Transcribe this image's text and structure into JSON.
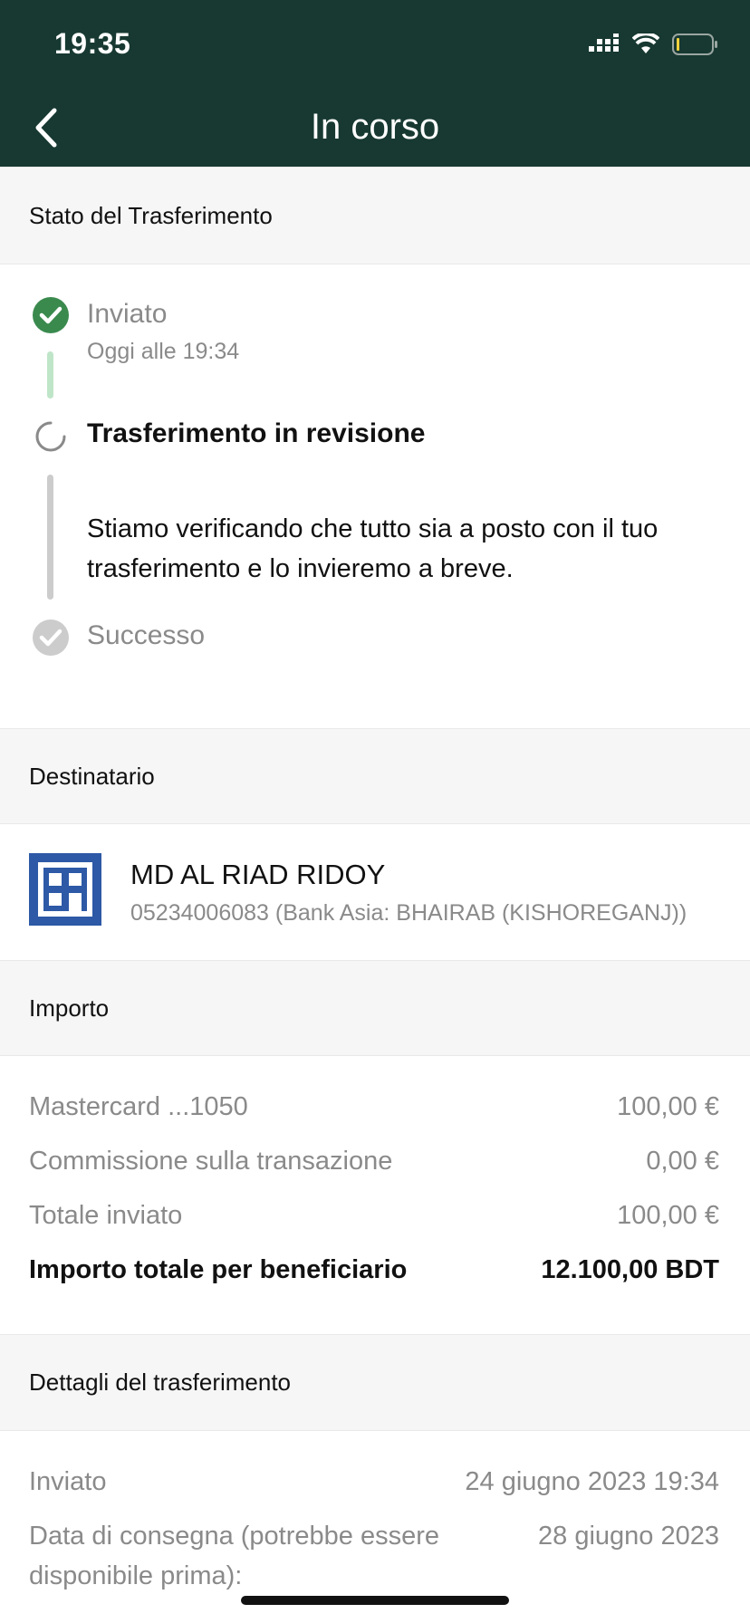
{
  "status_bar": {
    "time": "19:35"
  },
  "header": {
    "title": "In corso"
  },
  "status_section": {
    "heading": "Stato del Trasferimento",
    "steps": [
      {
        "title": "Inviato",
        "subtitle": "Oggi alle 19:34",
        "state": "done"
      },
      {
        "title": "Trasferimento in revisione",
        "description": "Stiamo verificando che tutto sia a posto con il tuo trasferimento e lo invieremo a breve.",
        "state": "in-progress"
      },
      {
        "title": "Successo",
        "state": "pending"
      }
    ]
  },
  "recipient_section": {
    "heading": "Destinatario",
    "name": "MD AL RIAD RIDOY",
    "account": "05234006083 (Bank Asia: BHAIRAB (KISHOREGANJ))"
  },
  "amount_section": {
    "heading": "Importo",
    "rows": [
      {
        "label": "Mastercard ...1050",
        "value": "100,00 €"
      },
      {
        "label": "Commissione sulla transazione",
        "value": "0,00 €"
      },
      {
        "label": "Totale inviato",
        "value": "100,00 €"
      }
    ],
    "total": {
      "label": "Importo totale per beneficiario",
      "value": "12.100,00 BDT"
    }
  },
  "details_section": {
    "heading": "Dettagli del trasferimento",
    "rows": [
      {
        "label": "Inviato",
        "value": "24 giugno 2023 19:34"
      },
      {
        "label": "Data di consegna (potrebbe essere disponibile prima):",
        "value": "28 giugno 2023"
      }
    ]
  },
  "colors": {
    "header_bg": "#173931",
    "success": "#3a8a4e",
    "progress_bar": "#bfe5c8",
    "pending": "#cccccc"
  }
}
